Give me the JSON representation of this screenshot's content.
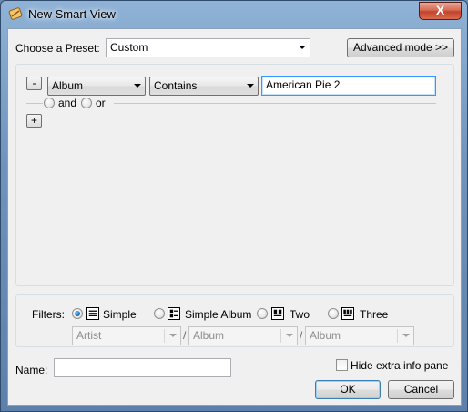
{
  "window": {
    "title": "New Smart View",
    "close_glyph": "X"
  },
  "preset": {
    "label": "Choose a Preset:",
    "value": "Custom"
  },
  "advanced_button": "Advanced mode >>",
  "rule": {
    "remove_glyph": "-",
    "field": "Album",
    "operator": "Contains",
    "value": "American Pie 2",
    "and_label": "and",
    "or_label": "or",
    "add_glyph": "+",
    "conjunction_selected": "none"
  },
  "filters": {
    "label": "Filters:",
    "options": [
      {
        "label": "Simple",
        "icon": "simple-view-icon",
        "selected": true
      },
      {
        "label": "Simple Album",
        "icon": "simple-album-view-icon",
        "selected": false
      },
      {
        "label": "Two",
        "icon": "two-view-icon",
        "selected": false
      },
      {
        "label": "Three",
        "icon": "three-view-icon",
        "selected": false
      }
    ],
    "combo1": "Artist",
    "combo2": "Album",
    "combo3": "Album",
    "separator": "/"
  },
  "name": {
    "label": "Name:",
    "value": ""
  },
  "hide_info_pane": {
    "label": "Hide extra info pane",
    "checked": false
  },
  "ok_button": "OK",
  "cancel_button": "Cancel",
  "colors": {
    "title_gradient_top": "#8fb2d6",
    "close_red": "#c2432b",
    "focus_blue": "#3399ff"
  }
}
